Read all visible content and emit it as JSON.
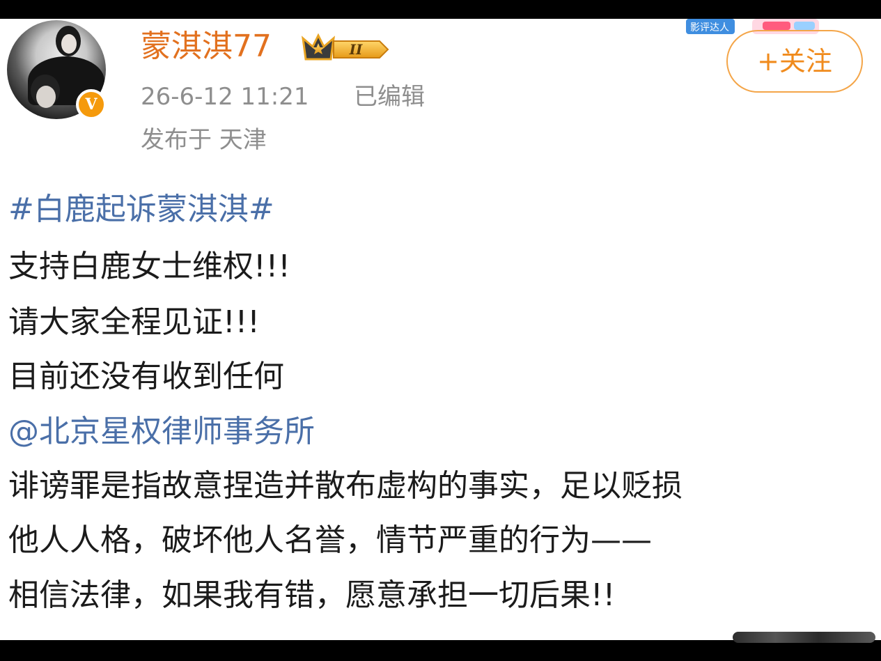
{
  "post": {
    "author": {
      "name": "蒙淇淇77",
      "level_badge": "II",
      "verified_mark": "V"
    },
    "time": "26-6-12 11:21",
    "edited": "已编辑",
    "location": "发布于 天津",
    "follow_label": "+关注",
    "corner_badge": "影评达人",
    "content": {
      "topic": "#白鹿起诉蒙淇淇#",
      "line1": "支持白鹿女士维权!!!",
      "line2": "请大家全程见证!!!",
      "line3": "目前还没有收到任何",
      "mention": "@北京星权律师事务所",
      "line4": "诽谤罪是指故意捏造并散布虚构的事实，足以贬损",
      "line5": "他人人格，破坏他人名誉，情节严重的行为——",
      "line6": "相信法律，如果我有错，愿意承担一切后果!!"
    }
  },
  "colors": {
    "username": "#e2711f",
    "link": "#4a6fa8",
    "meta": "#8e8e8e",
    "follow_border": "#f4a548",
    "follow_text": "#f08b1d",
    "verified_badge": "#f59a0c"
  },
  "icons": {
    "verified": "verified-v-icon",
    "crown": "crown-level-icon"
  }
}
